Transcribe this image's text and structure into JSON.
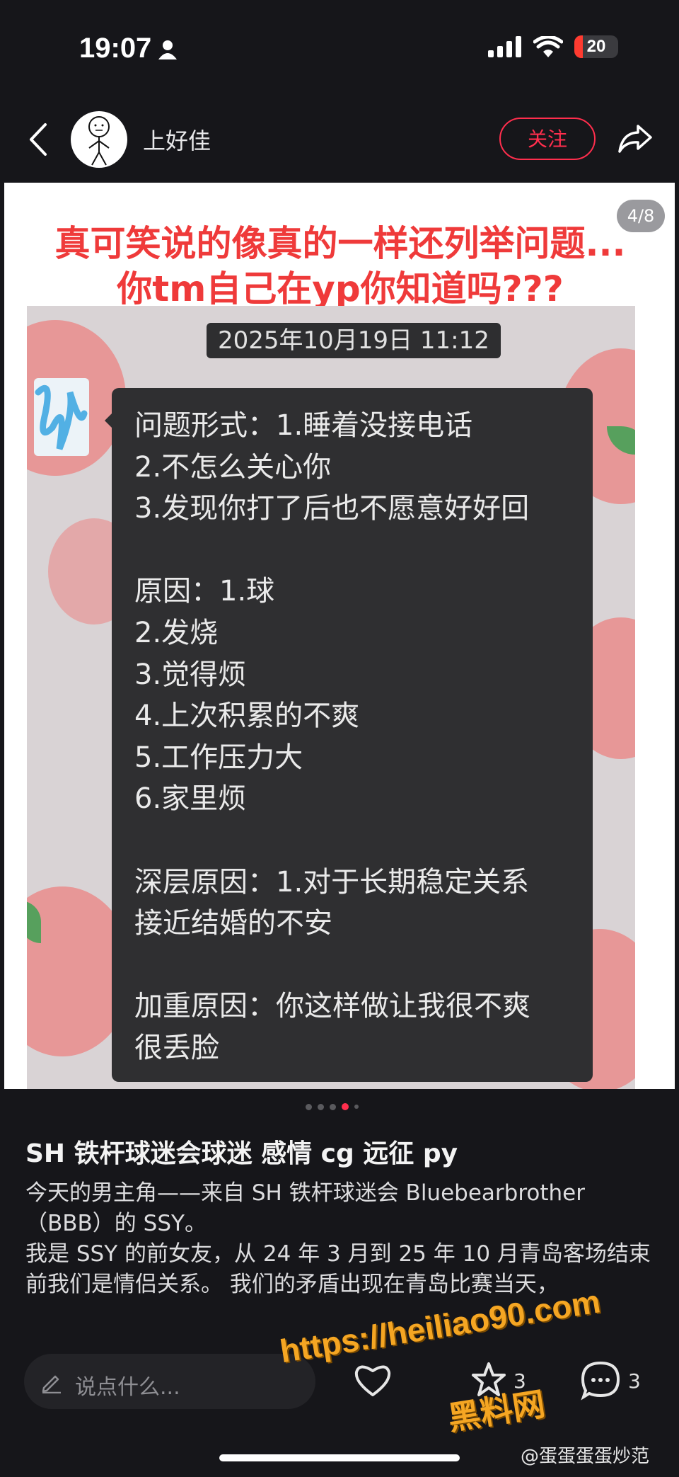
{
  "status_bar": {
    "time": "19:07",
    "battery": "20",
    "battery_level": 0.2
  },
  "header": {
    "username": "上好佳",
    "follow_label": "关注"
  },
  "image": {
    "page_indicator": "4/8",
    "headline": "真可笑说的像真的一样还列举问题...\n你tm自己在yp你知道吗???",
    "timestamp": "2025年10月19日 11:12",
    "message": "问题形式：1.睡着没接电话\n2.不怎么关心你\n3.发现你打了后也不愿意好好回\n\n原因：1.球\n2.发烧\n3.觉得烦\n4.上次积累的不爽\n5.工作压力大\n6.家里烦\n\n深层原因：1.对于长期稳定关系\n接近结婚的不安\n\n加重原因：你这样做让我很不爽\n很丢脸"
  },
  "post": {
    "title": "SH 铁杆球迷会球迷  感情 cg 远征 py",
    "paragraphs": [
      "今天的男主角——来自 SH 铁杆球迷会 Bluebearbrother（BBB）的 SSY。",
      "我是 SSY 的前女友，从 24 年 3 月到 25 年 10 月青岛客场结束前我们是情侣关系。 我们的矛盾出现在青岛比赛当天，"
    ]
  },
  "bottom_bar": {
    "comment_placeholder": "说点什么...",
    "collect_count": "3",
    "comment_count": "3"
  },
  "watermark": {
    "url": "https://heiliao90.com",
    "name": "黑料网",
    "source": "@蛋蛋蛋蛋炒范"
  },
  "colors": {
    "accent": "#ff2e4d",
    "headline": "#ef3a3a",
    "background": "#16161a"
  }
}
